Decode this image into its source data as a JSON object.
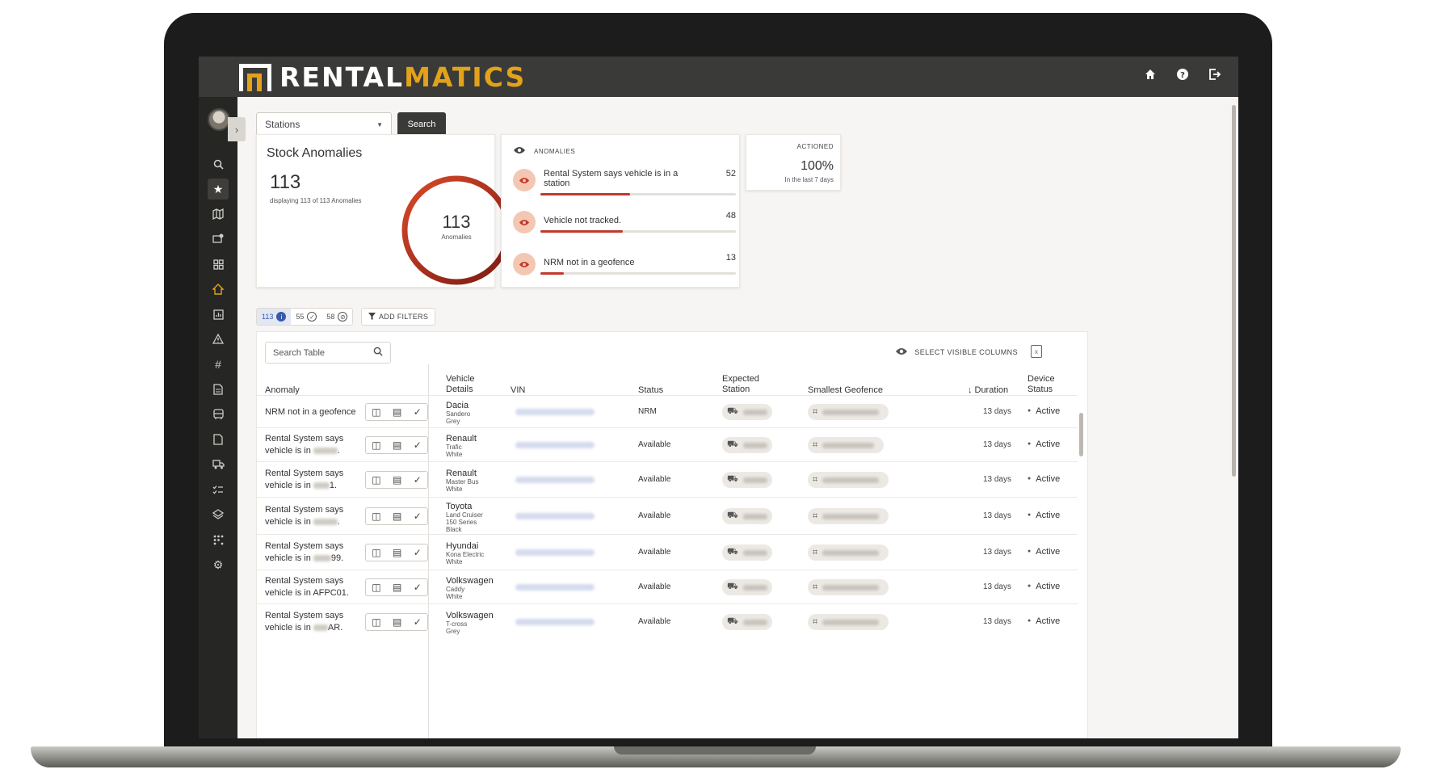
{
  "app": {
    "logo_part1": "RENTAL",
    "logo_part2": "MATICS",
    "accent": "#e3a21b",
    "alert_color": "#c0392b"
  },
  "topbar": {
    "icons": [
      "home-icon",
      "help-icon",
      "logout-icon"
    ]
  },
  "sidebar": {
    "icons": [
      "search-icon",
      "star-icon",
      "map-icon",
      "message-alert-icon",
      "dashboard-icon",
      "home-icon",
      "report-icon",
      "warning-icon",
      "hash-icon",
      "document-icon",
      "bus-icon",
      "file-icon",
      "truck-icon",
      "checklist-icon",
      "layers-icon",
      "grid-dots-icon",
      "settings-icon"
    ]
  },
  "filter": {
    "select_value": "Stations",
    "search_label": "Search"
  },
  "stock_anomalies": {
    "title": "Stock Anomalies",
    "count": "113",
    "subtitle": "displaying 113 of 113 Anomalies",
    "donut_value": "113",
    "donut_label": "Anomalies"
  },
  "anomalies": {
    "heading": "ANOMALIES",
    "items": [
      {
        "label": "Rental System says vehicle is in a station",
        "value": "52",
        "fraction": 0.46
      },
      {
        "label": "Vehicle not tracked.",
        "value": "48",
        "fraction": 0.42
      },
      {
        "label": "NRM not in a geofence",
        "value": "13",
        "fraction": 0.12
      }
    ]
  },
  "actioned": {
    "heading": "ACTIONED",
    "value": "100%",
    "subtitle": "In the last 7 days"
  },
  "chips": [
    {
      "count": "113",
      "icon": "info-icon"
    },
    {
      "count": "55",
      "icon": "check-circle-icon"
    },
    {
      "count": "58",
      "icon": "not-tracked-icon"
    }
  ],
  "add_filters_label": "ADD FILTERS",
  "table": {
    "search_placeholder": "Search Table",
    "select_columns_label": "SELECT VISIBLE COLUMNS",
    "headers": {
      "anomaly": "Anomaly",
      "vehicle": "Vehicle\nDetails",
      "vin": "VIN",
      "status": "Status",
      "expected": "Expected\nStation",
      "geofence": "Smallest Geofence",
      "duration": "Duration",
      "device": "Device\nStatus"
    },
    "rows": [
      {
        "anomaly": "NRM not in a geofence",
        "make": "Dacia",
        "model": "Sandero",
        "color": "Grey",
        "status": "NRM",
        "duration": "13 days",
        "device": "Active"
      },
      {
        "anomaly": "Rental System says vehicle is in",
        "anomaly_tail": ".",
        "make": "Renault",
        "model": "Trafic",
        "color": "White",
        "status": "Available",
        "duration": "13 days",
        "device": "Active"
      },
      {
        "anomaly": "Rental System says vehicle is in",
        "anomaly_tail": "1.",
        "make": "Renault",
        "model": "Master Bus",
        "color": "White",
        "status": "Available",
        "duration": "13 days",
        "device": "Active"
      },
      {
        "anomaly": "Rental System says vehicle is in",
        "anomaly_tail": ".",
        "make": "Toyota",
        "model": "Land Cruiser 150 Series",
        "color": "Black",
        "status": "Available",
        "duration": "13 days",
        "device": "Active"
      },
      {
        "anomaly": "Rental System says vehicle is in",
        "anomaly_tail": "99.",
        "make": "Hyundai",
        "model": "Kona Electric",
        "color": "White",
        "status": "Available",
        "duration": "13 days",
        "device": "Active"
      },
      {
        "anomaly": "Rental System says vehicle is in",
        "anomaly_tail": "AFPC01.",
        "make": "Volkswagen",
        "model": "Caddy",
        "color": "White",
        "status": "Available",
        "duration": "13 days",
        "device": "Active"
      },
      {
        "anomaly": "Rental System says vehicle is in",
        "anomaly_tail": "AR.",
        "make": "Volkswagen",
        "model": "T-cross",
        "color": "Grey",
        "status": "Available",
        "duration": "13 days",
        "device": "Active"
      }
    ]
  }
}
